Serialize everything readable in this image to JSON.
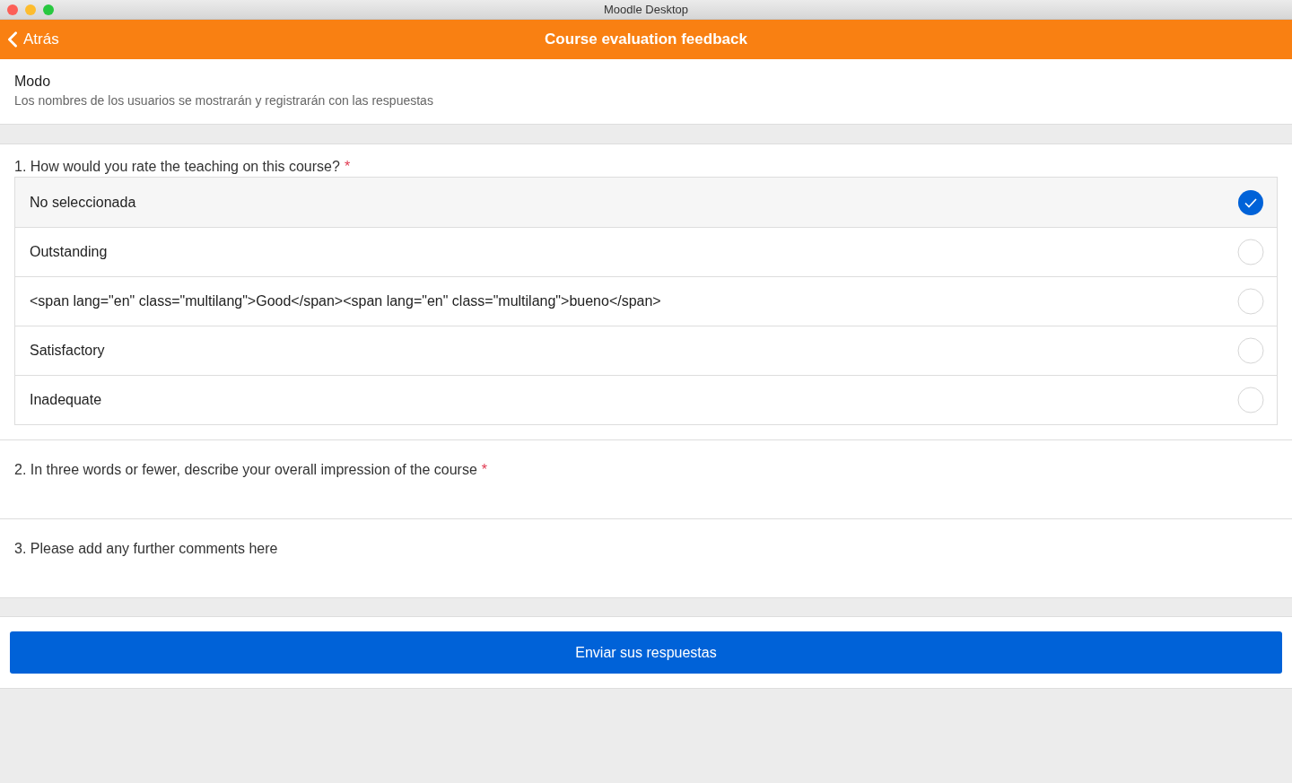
{
  "window": {
    "title": "Moodle Desktop"
  },
  "header": {
    "back_label": "Atrás",
    "title": "Course evaluation feedback"
  },
  "mode": {
    "label": "Modo",
    "description": "Los nombres de los usuarios se mostrarán y registrarán con las respuestas"
  },
  "questions": [
    {
      "kind": "radio",
      "label": "1. How would you rate the teaching on this course?",
      "required_mark": "*",
      "options": [
        {
          "label": "No seleccionada",
          "selected": true
        },
        {
          "label": "Outstanding",
          "selected": false
        },
        {
          "label": "<span lang=\"en\" class=\"multilang\">Good</span><span lang=\"en\" class=\"multilang\">bueno</span>",
          "selected": false
        },
        {
          "label": "Satisfactory",
          "selected": false
        },
        {
          "label": "Inadequate",
          "selected": false
        }
      ]
    },
    {
      "kind": "text",
      "label": "2. In three words or fewer, describe your overall impression of the course",
      "required_mark": "*"
    },
    {
      "kind": "text",
      "label": "3. Please add any further comments here"
    }
  ],
  "submit": {
    "label": "Enviar sus respuestas"
  }
}
